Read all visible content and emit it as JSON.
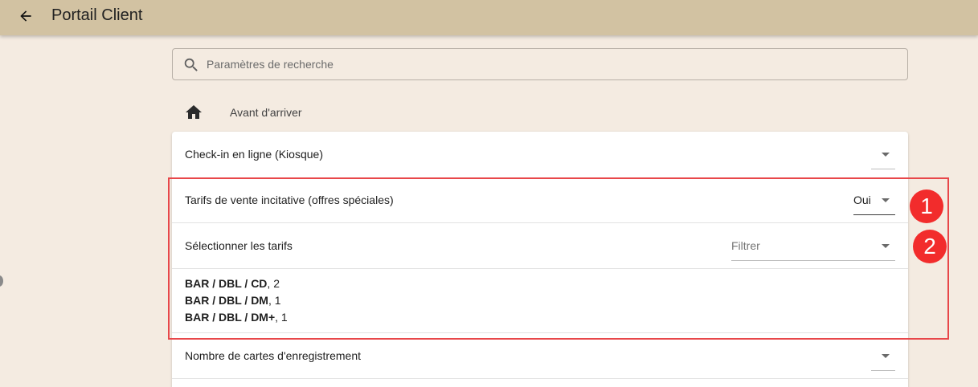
{
  "appbar": {
    "title": "Portail Client",
    "back_icon": "arrow-left-icon",
    "color": "#d2c2a2"
  },
  "search": {
    "placeholder": "Paramètres de recherche",
    "value": "",
    "icon": "search-icon"
  },
  "breadcrumb": {
    "icon": "home-icon",
    "label": "Avant d'arriver"
  },
  "settings": [
    {
      "label": "Check-in en ligne (Kiosque)",
      "value": ""
    },
    {
      "label": "Tarifs de vente incitative (offres spéciales)",
      "value": "Oui"
    },
    {
      "label": "Sélectionner les tarifs",
      "placeholder": "Filtrer"
    },
    {
      "label": "Nombre de cartes d'enregistrement",
      "value": ""
    }
  ],
  "selected_rates": [
    {
      "code": "BAR / DBL / CD",
      "suffix": ", 2"
    },
    {
      "code": "BAR / DBL / DM",
      "suffix": ", 1"
    },
    {
      "code": "BAR / DBL / DM+",
      "suffix": ", 1"
    }
  ],
  "annotations": {
    "badges": [
      "1",
      "2"
    ],
    "color": "#e8474a"
  },
  "colors": {
    "background": "#f4ebe1",
    "card": "#ffffff"
  }
}
